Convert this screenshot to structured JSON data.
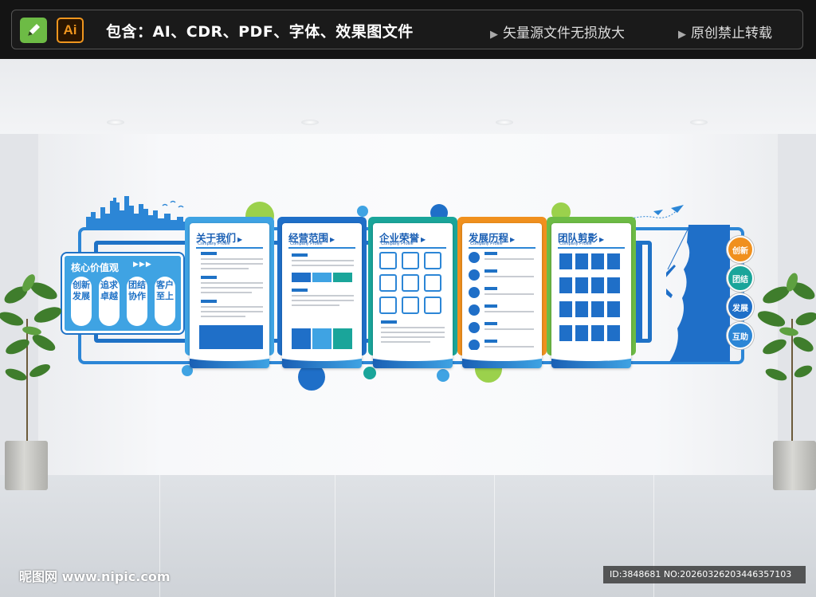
{
  "banner": {
    "tool_pen": "pen-tool-icon",
    "tool_ai": "Ai",
    "title": "包含：AI、CDR、PDF、字体、效果图文件",
    "note_1": "矢量源文件无损放大",
    "note_2": "原创禁止转载"
  },
  "core_values": {
    "title": "核心价值观",
    "items": [
      "创新发展",
      "追求卓越",
      "团结协作",
      "客户至上"
    ]
  },
  "panels": [
    {
      "title": "关于我们",
      "subtitle": "Company Profile",
      "accent": "#3fa3e3"
    },
    {
      "title": "经营范围",
      "subtitle": "Company Profile",
      "accent": "#1f6fc8"
    },
    {
      "title": "企业荣誉",
      "subtitle": "Company Profile",
      "accent": "#1aa59a"
    },
    {
      "title": "发展历程",
      "subtitle": "Company Profile",
      "accent": "#f0901e"
    },
    {
      "title": "团队剪影",
      "subtitle": "Company Profile",
      "accent": "#6dbb45"
    }
  ],
  "badges": [
    {
      "label": "创新",
      "color": "#f0901e"
    },
    {
      "label": "团结",
      "color": "#1aa59a"
    },
    {
      "label": "发展",
      "color": "#1f6fc8"
    },
    {
      "label": "互助",
      "color": "#2c86d6"
    }
  ],
  "watermark": {
    "logo": "昵图网 www.nipic.com",
    "id": "ID:3848681 NO:20260326203446357103"
  },
  "colors": {
    "primary_blue": "#1f72c6",
    "light_blue": "#3fa3e3",
    "teal": "#1aa59a",
    "orange": "#f0901e",
    "green": "#6dbb45"
  }
}
